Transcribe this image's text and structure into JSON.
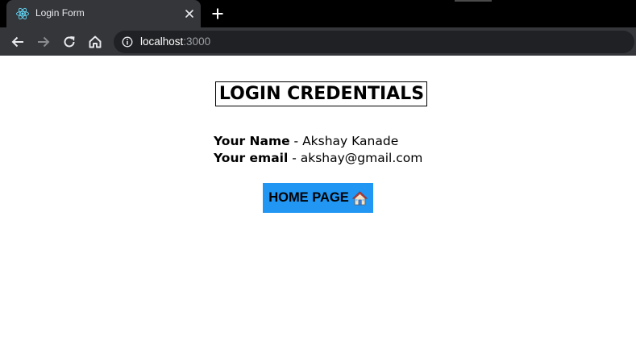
{
  "browser": {
    "tab_title": "Login Form",
    "url_host": "localhost",
    "url_port": ":3000",
    "icons": {
      "favicon": "react-icon",
      "tab_close": "close-icon",
      "new_tab": "plus-icon",
      "back": "arrow-left-icon",
      "forward": "arrow-right-icon",
      "reload": "reload-icon",
      "home": "home-icon",
      "site_info": "info-icon"
    }
  },
  "page": {
    "title": "LOGIN CREDENTIALS",
    "name_label": "Your Name",
    "name_value": " - Akshay Kanade",
    "email_label": "Your email",
    "email_value": " - akshay@gmail.com",
    "home_button_label": "HOME PAGE",
    "home_button_icon": "house-icon"
  },
  "colors": {
    "button_bg": "#2196f3",
    "chrome_dark": "#35363a",
    "tabstrip": "#000000",
    "omnibox": "#202124"
  }
}
